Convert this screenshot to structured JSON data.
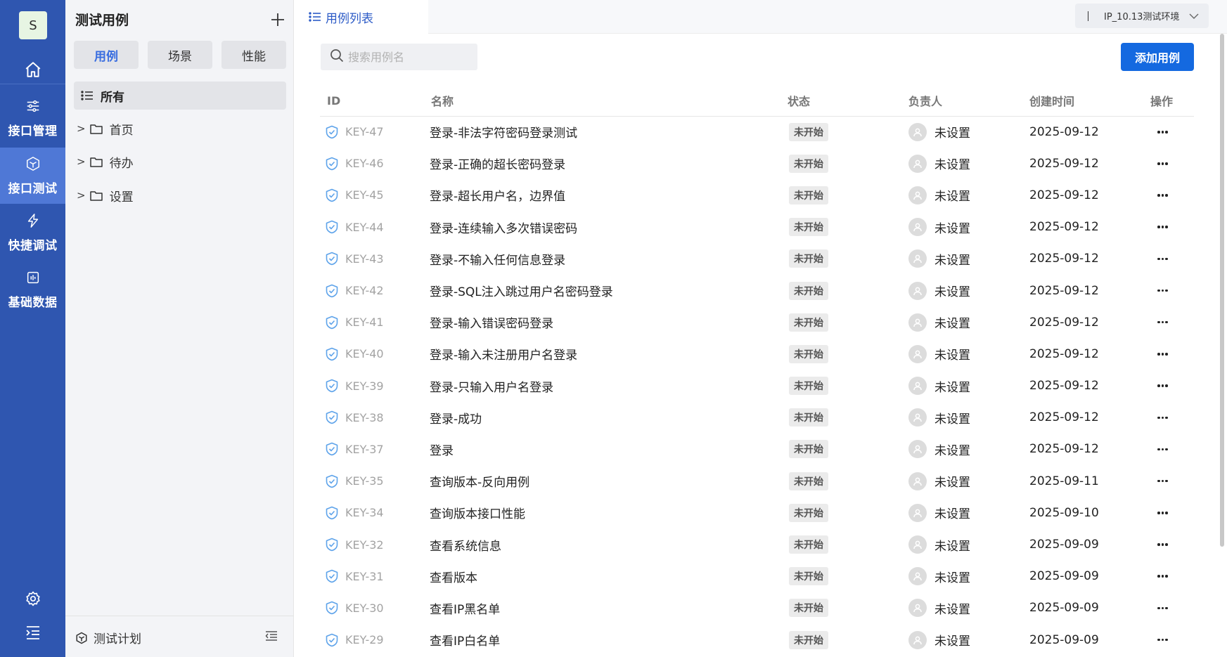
{
  "rail": {
    "avatar_letter": "S",
    "nav": [
      {
        "label": "接口管理",
        "icon": "sliders-icon"
      },
      {
        "label": "接口测试",
        "icon": "hexagon-icon",
        "active": true
      },
      {
        "label": "快捷调试",
        "icon": "lightning-icon"
      },
      {
        "label": "基础数据",
        "icon": "chart-icon"
      }
    ]
  },
  "tree": {
    "title": "测试用例",
    "segments": [
      "用例",
      "场景",
      "性能"
    ],
    "all_label": "所有",
    "folders": [
      "首页",
      "待办",
      "设置"
    ],
    "footer_label": "测试计划"
  },
  "topbar": {
    "tab_label": "用例列表",
    "env_label": "IP_10.13测试环境"
  },
  "toolbar": {
    "search_placeholder": "搜索用例名",
    "add_label": "添加用例"
  },
  "table": {
    "headers": {
      "id": "ID",
      "name": "名称",
      "status": "状态",
      "owner": "负责人",
      "created": "创建时间",
      "ops": "操作"
    },
    "rows": [
      {
        "id": "KEY-47",
        "name": "登录-非法字符密码登录测试",
        "status": "未开始",
        "owner": "未设置",
        "created": "2025-09-12"
      },
      {
        "id": "KEY-46",
        "name": "登录-正确的超长密码登录",
        "status": "未开始",
        "owner": "未设置",
        "created": "2025-09-12"
      },
      {
        "id": "KEY-45",
        "name": "登录-超长用户名，边界值",
        "status": "未开始",
        "owner": "未设置",
        "created": "2025-09-12"
      },
      {
        "id": "KEY-44",
        "name": "登录-连续输入多次错误密码",
        "status": "未开始",
        "owner": "未设置",
        "created": "2025-09-12"
      },
      {
        "id": "KEY-43",
        "name": "登录-不输入任何信息登录",
        "status": "未开始",
        "owner": "未设置",
        "created": "2025-09-12"
      },
      {
        "id": "KEY-42",
        "name": "登录-SQL注入跳过用户名密码登录",
        "status": "未开始",
        "owner": "未设置",
        "created": "2025-09-12"
      },
      {
        "id": "KEY-41",
        "name": "登录-输入错误密码登录",
        "status": "未开始",
        "owner": "未设置",
        "created": "2025-09-12"
      },
      {
        "id": "KEY-40",
        "name": "登录-输入未注册用户名登录",
        "status": "未开始",
        "owner": "未设置",
        "created": "2025-09-12"
      },
      {
        "id": "KEY-39",
        "name": "登录-只输入用户名登录",
        "status": "未开始",
        "owner": "未设置",
        "created": "2025-09-12"
      },
      {
        "id": "KEY-38",
        "name": "登录-成功",
        "status": "未开始",
        "owner": "未设置",
        "created": "2025-09-12"
      },
      {
        "id": "KEY-37",
        "name": "登录",
        "status": "未开始",
        "owner": "未设置",
        "created": "2025-09-12"
      },
      {
        "id": "KEY-35",
        "name": "查询版本-反向用例",
        "status": "未开始",
        "owner": "未设置",
        "created": "2025-09-11"
      },
      {
        "id": "KEY-34",
        "name": "查询版本接口性能",
        "status": "未开始",
        "owner": "未设置",
        "created": "2025-09-10"
      },
      {
        "id": "KEY-32",
        "name": "查看系统信息",
        "status": "未开始",
        "owner": "未设置",
        "created": "2025-09-09"
      },
      {
        "id": "KEY-31",
        "name": "查看版本",
        "status": "未开始",
        "owner": "未设置",
        "created": "2025-09-09"
      },
      {
        "id": "KEY-30",
        "name": "查看IP黑名单",
        "status": "未开始",
        "owner": "未设置",
        "created": "2025-09-09"
      },
      {
        "id": "KEY-29",
        "name": "查看IP白名单",
        "status": "未开始",
        "owner": "未设置",
        "created": "2025-09-09"
      }
    ]
  },
  "colors": {
    "rail": "#2f56b0",
    "rail_active": "#4f78d6",
    "primary": "#1469e0",
    "accent_text": "#2c5bc7"
  }
}
